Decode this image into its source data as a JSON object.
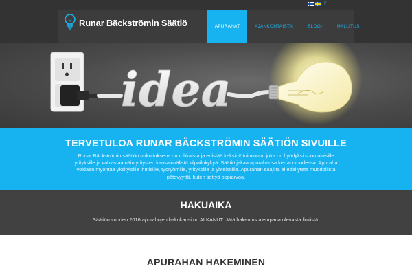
{
  "header": {
    "site_name": "Runar Bäckströmin Säätiö",
    "logo_icon": "lightbulb-logo-icon",
    "nav": [
      {
        "label": "APURAHAT",
        "active": true
      },
      {
        "label": "AJANKOHTAISTA",
        "active": false
      },
      {
        "label": "BLOGI",
        "active": false
      },
      {
        "label": "HALLITUS",
        "active": false
      }
    ],
    "languages": [
      {
        "icon": "finland-flag-icon"
      },
      {
        "icon": "sweden-flag-icon"
      }
    ],
    "social_icon": "facebook-icon",
    "social_glyph": "f"
  },
  "hero": {
    "word": "idea",
    "image_icons": [
      "power-outlet-icon",
      "plug-icon",
      "lightbulb-icon"
    ]
  },
  "welcome": {
    "title": "TERVETULOA RUNAR BÄCKSTRÖMIN SÄÄTIÖN SIVUILLE",
    "text": "Runar Bäckströmin säätiön tarkoituksena on rohkaista ja edistää keksintötoimintaa, joka on hyödyksi suomalaisille yrityksille ja vahvistaa näin yritysten kansainvälistä kilpailukykyä. Säätiö jakaa apurahansa kerran vuodessa. Apuraha voidaan myöntää yksityisille ihmisille, työryhmille, yrityksille ja yhteisöille. Apurahan saajilta ei edellytetä muodollista pätevyyttä, kuten tiettyä oppiarvoa."
  },
  "hakuaika": {
    "title": "HAKUAIKA",
    "text": "Säätiön vuoden 2016 apurahojen hakukausi on ALKANUT. Jätä hakemus alempana olevasta linkistä."
  },
  "apply": {
    "title": "APURAHAN HAKEMINEN"
  },
  "colors": {
    "accent": "#17b3f0",
    "header_bg": "#333333",
    "dark_section": "#414141"
  }
}
